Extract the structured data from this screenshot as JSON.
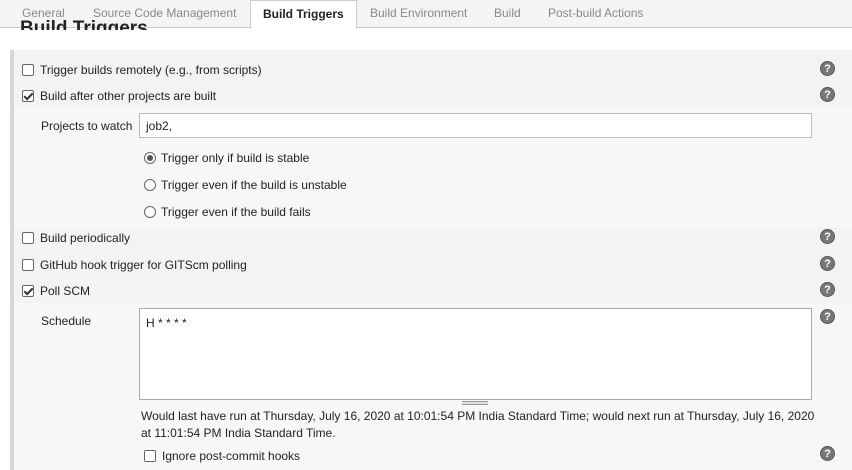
{
  "tabs": [
    {
      "label": "General"
    },
    {
      "label": "Source Code Management"
    },
    {
      "label": "Build Triggers",
      "active": true
    },
    {
      "label": "Build Environment"
    },
    {
      "label": "Build"
    },
    {
      "label": "Post-build Actions"
    }
  ],
  "section_title": "Build Triggers",
  "triggers": {
    "remote": {
      "label": "Trigger builds remotely (e.g., from scripts)",
      "checked": false
    },
    "after_other": {
      "label": "Build after other projects are built",
      "checked": true
    },
    "periodic": {
      "label": "Build periodically",
      "checked": false
    },
    "github_hook": {
      "label": "GitHub hook trigger for GITScm polling",
      "checked": false
    },
    "poll_scm": {
      "label": "Poll SCM",
      "checked": true
    }
  },
  "projects_to_watch": {
    "label": "Projects to watch",
    "value": "job2,"
  },
  "radio_options": [
    {
      "label": "Trigger only if build is stable",
      "selected": true
    },
    {
      "label": "Trigger even if the build is unstable",
      "selected": false
    },
    {
      "label": "Trigger even if the build fails",
      "selected": false
    }
  ],
  "schedule": {
    "label": "Schedule",
    "value": "H * * * *",
    "note": "Would last have run at Thursday, July 16, 2020 at 10:01:54 PM India Standard Time; would next run at Thursday, July 16, 2020 at 11:01:54 PM India Standard Time."
  },
  "ignore_post_commit": {
    "label": "Ignore post-commit hooks",
    "checked": false
  },
  "help_glyph": "?",
  "icons": {
    "help": "help-icon"
  }
}
